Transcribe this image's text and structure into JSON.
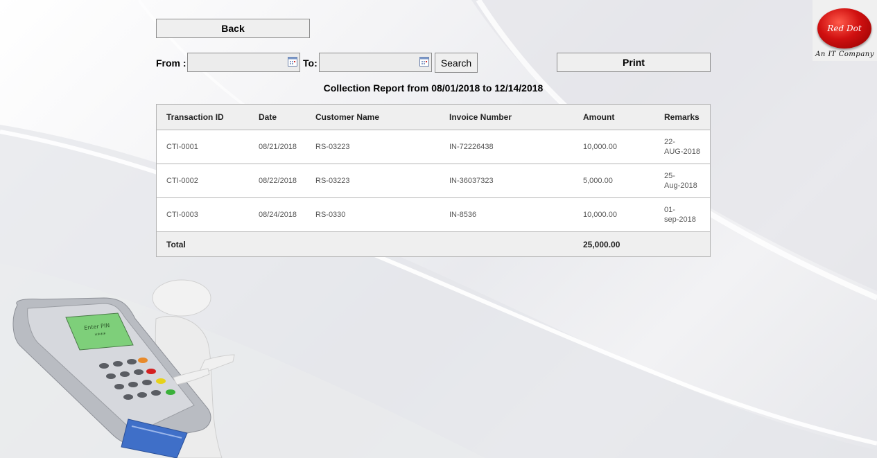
{
  "toolbar": {
    "back_label": "Back",
    "from_label": "From :",
    "to_label": "To:",
    "from_value": "",
    "to_value": "",
    "search_label": "Search",
    "print_label": "Print"
  },
  "report": {
    "title": "Collection Report from 08/01/2018 to 12/14/2018",
    "columns": [
      "Transaction ID",
      "Date",
      "Customer Name",
      "Invoice Number",
      "Amount",
      "Remarks"
    ],
    "rows": [
      {
        "transaction_id": "CTI-0001",
        "date": "08/21/2018",
        "customer": "RS-03223",
        "invoice": "IN-72226438",
        "amount": "10,000.00",
        "remarks_1": "22-",
        "remarks_2": "AUG-2018"
      },
      {
        "transaction_id": "CTI-0002",
        "date": "08/22/2018",
        "customer": "RS-03223",
        "invoice": "IN-36037323",
        "amount": "5,000.00",
        "remarks_1": "25-",
        "remarks_2": "Aug-2018"
      },
      {
        "transaction_id": "CTI-0003",
        "date": "08/24/2018",
        "customer": "RS-0330",
        "invoice": "IN-8536",
        "amount": "10,000.00",
        "remarks_1": "01-",
        "remarks_2": "sep-2018"
      }
    ],
    "total_label": "Total",
    "total_amount": "25,000.00"
  },
  "logo": {
    "name": "Red Dot",
    "tagline": "An IT Company"
  },
  "illustration": {
    "screen_text": "Enter PIN",
    "pin_mask": "****"
  },
  "colors": {
    "logo_red": "#d01010",
    "button_bg": "#efefef",
    "table_header_bg": "#efefef"
  }
}
